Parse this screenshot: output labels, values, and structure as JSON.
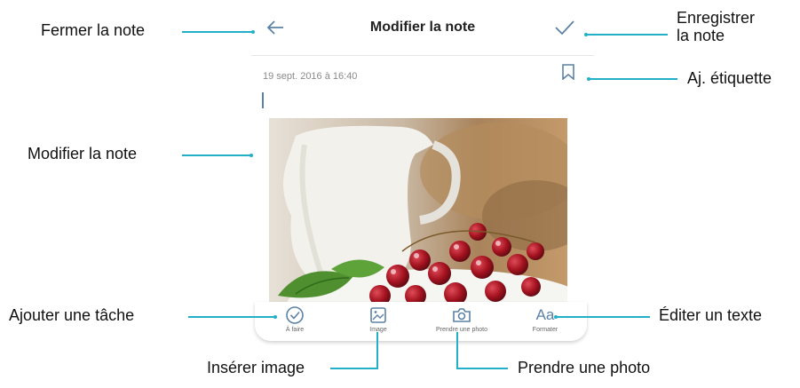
{
  "header": {
    "title": "Modifier la note",
    "back_icon": "arrow-left-icon",
    "save_icon": "checkmark-icon"
  },
  "note": {
    "date": "19 sept. 2016 à 16:40",
    "bookmark_icon": "bookmark-icon"
  },
  "toolbar": {
    "items": [
      {
        "label": "À faire",
        "icon": "check-circle-icon"
      },
      {
        "label": "Image",
        "icon": "image-icon"
      },
      {
        "label": "Prendre une photo",
        "icon": "camera-icon"
      },
      {
        "label": "Formater",
        "icon": "text-format-icon",
        "glyph": "Aa"
      }
    ]
  },
  "callouts": {
    "close_note": "Fermer la note",
    "save_note_line1": "Enregistrer",
    "save_note_line2": "la note",
    "add_label": "Aj. étiquette",
    "edit_note": "Modifier la note",
    "add_task": "Ajouter une tâche",
    "edit_text": "Éditer un texte",
    "insert_image": "Insérer image",
    "take_photo": "Prendre une photo"
  },
  "colors": {
    "accent": "#5b82a6",
    "callout_line": "#21b0c8"
  }
}
